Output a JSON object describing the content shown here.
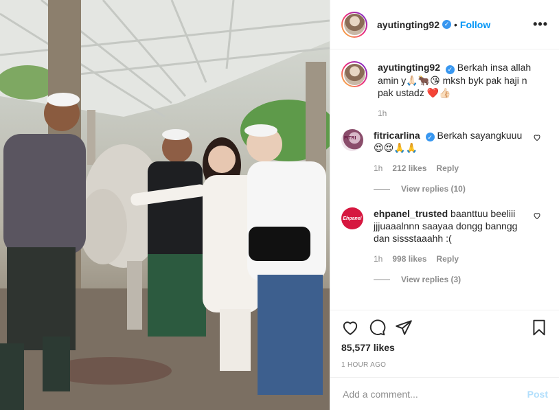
{
  "post": {
    "username": "ayutingting92",
    "follow_label": "Follow",
    "separator": "•",
    "caption": "Berkah insa allah amin y🙏🏻🐂😘 mksh byk pak haji n pak ustadz ❤️👍🏻",
    "caption_time": "1h"
  },
  "comments": [
    {
      "username": "fitricarlina",
      "text": "Berkah sayangkuuu 😍😍🙏🙏",
      "time": "1h",
      "likes": "212 likes",
      "reply_label": "Reply",
      "view_replies": "View replies (10)",
      "avatar_label": "FITRI"
    },
    {
      "username": "ehpanel_trusted",
      "text": "baanttuu beeliii jjjuaaalnnn saayaa dongg banngg dan sissstaaahh :(",
      "time": "1h",
      "likes": "998 likes",
      "reply_label": "Reply",
      "view_replies": "View replies (3)",
      "avatar_label": "Ehpanel"
    }
  ],
  "footer": {
    "likes": "85,577 likes",
    "time": "1 HOUR AGO",
    "comment_placeholder": "Add a comment...",
    "post_label": "Post"
  },
  "icons": {
    "like": "heart-icon",
    "comment": "comment-icon",
    "share": "share-icon",
    "save": "bookmark-icon",
    "more": "more-icon",
    "verified": "verified-icon"
  },
  "colors": {
    "link_blue": "#0095f6",
    "verified_blue": "#3897f0",
    "muted": "#8e8e8e",
    "post_disabled": "#b2dffc",
    "ehpanel_red": "#d6173f"
  }
}
